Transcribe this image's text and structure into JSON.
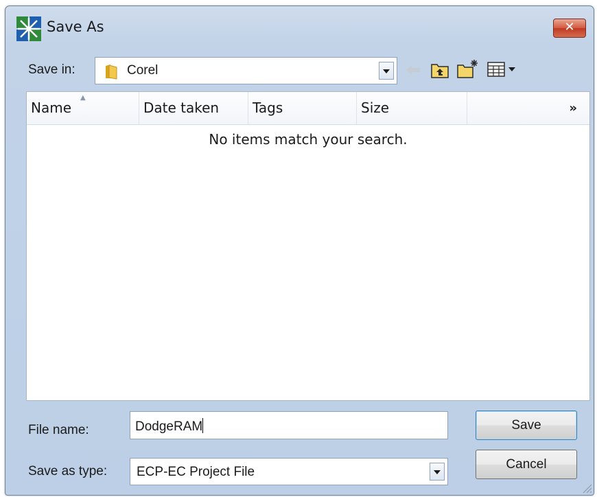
{
  "window": {
    "title": "Save As",
    "close_symbol": "✕"
  },
  "toolbar": {
    "save_in_label": "Save in:",
    "save_in_value": "Corel",
    "icons": [
      "back-arrow-icon",
      "up-folder-icon",
      "new-folder-icon",
      "views-menu-icon"
    ]
  },
  "file_list": {
    "columns": [
      "Name",
      "Date taken",
      "Tags",
      "Size"
    ],
    "more_columns": "»",
    "empty_message": "No items match your search."
  },
  "footer": {
    "file_name_label": "File name:",
    "file_name_value": "DodgeRAM",
    "save_as_type_label": "Save as type:",
    "save_as_type_value": "ECP-EC Project File",
    "save_button": "Save",
    "cancel_button": "Cancel"
  }
}
